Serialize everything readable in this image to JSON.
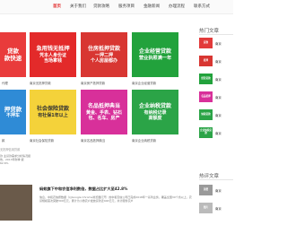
{
  "nav": {
    "items": [
      "首页",
      "关于我们",
      "贷款攻略",
      "服务项目",
      "金融新闻",
      "办理流程",
      "联系方式"
    ],
    "active_index": 0
  },
  "cards": [
    {
      "lines": [
        "贷款",
        "款快速"
      ],
      "caption": "代理",
      "bg": "#e93b3b"
    },
    {
      "lines": [
        "急用钱无抵押",
        "凭本人身份证",
        "当场拿钱"
      ],
      "caption": "南京无抵押贷款",
      "bg": "#e32a2a"
    },
    {
      "lines": [
        "住房抵押贷款",
        "一押二押",
        "个人房屋都办"
      ],
      "caption": "南京房产抵押贷款",
      "bg": "#d83632"
    },
    {
      "lines": [
        "企业经营贷款",
        "营业执照满一年"
      ],
      "caption": "南京企业经营贷款",
      "bg": "#22a23c"
    },
    {
      "lines": [
        "押贷款",
        "不押车"
      ],
      "caption": "款",
      "bg": "#2f8bd6"
    },
    {
      "lines": [
        "社会保险贷款",
        "有社保1年以上"
      ],
      "caption": "南京社会保险贷款",
      "bg": "#f4d23a",
      "dark": true
    },
    {
      "lines": [
        "名品抵押典当",
        "黄金、手表、钻石",
        "包、名车、房产"
      ],
      "caption": "南京名品抵押典当",
      "bg": "#d8309a"
    },
    {
      "lines": [
        "企业纳税贷款",
        "有纳税记录",
        "高额度"
      ],
      "caption": "南京企业纳税贷款",
      "bg": "#2ba447"
    }
  ],
  "sidebar": {
    "hot_title": "热门文章",
    "hot_items": [
      {
        "thumb": "贷款",
        "text": "南京",
        "bg": "#e23a3a"
      },
      {
        "thumb": "抵押",
        "text": "南京",
        "bg": "#d83632"
      },
      {
        "thumb": "经营贷款",
        "text": "南京",
        "bg": "#22a23c"
      },
      {
        "thumb": "名品抵押",
        "text": "南京",
        "bg": "#d8309a"
      },
      {
        "thumb": "纳税贷款",
        "text": "南京",
        "bg": "#2ba447"
      },
      {
        "thumb": "企业纳税贷款",
        "text": "南京",
        "bg": "#2ba447"
      }
    ],
    "recent_title": "热评文章",
    "recent_items": [
      {
        "thumb": "消费",
        "text": "南京",
        "bg": "#9a9a9a"
      },
      {
        "thumb": "图片",
        "text": "南京",
        "bg": "#bbbbbb"
      }
    ]
  },
  "articles": [
    {
      "meta": "无抵押信用贷款",
      "title": "",
      "text": "款 业贷款需求分析情况报告，2013年财季 额62.6%"
    },
    {
      "meta": "",
      "title": "蚂蚁旗下中和农信净利数倍，数据占比扩大至42.8%",
      "text": "信息，中和农信按数据（以Google Chrome浏览器打开）的中和农信公司已完成2018年一系列业务，覆盖全国30个省以上，农贷规模首次突破300亿元，累计为小微农户发放贷款近400亿元，共计服务农户"
    }
  ],
  "colors": {
    "accent": "#e23232"
  }
}
